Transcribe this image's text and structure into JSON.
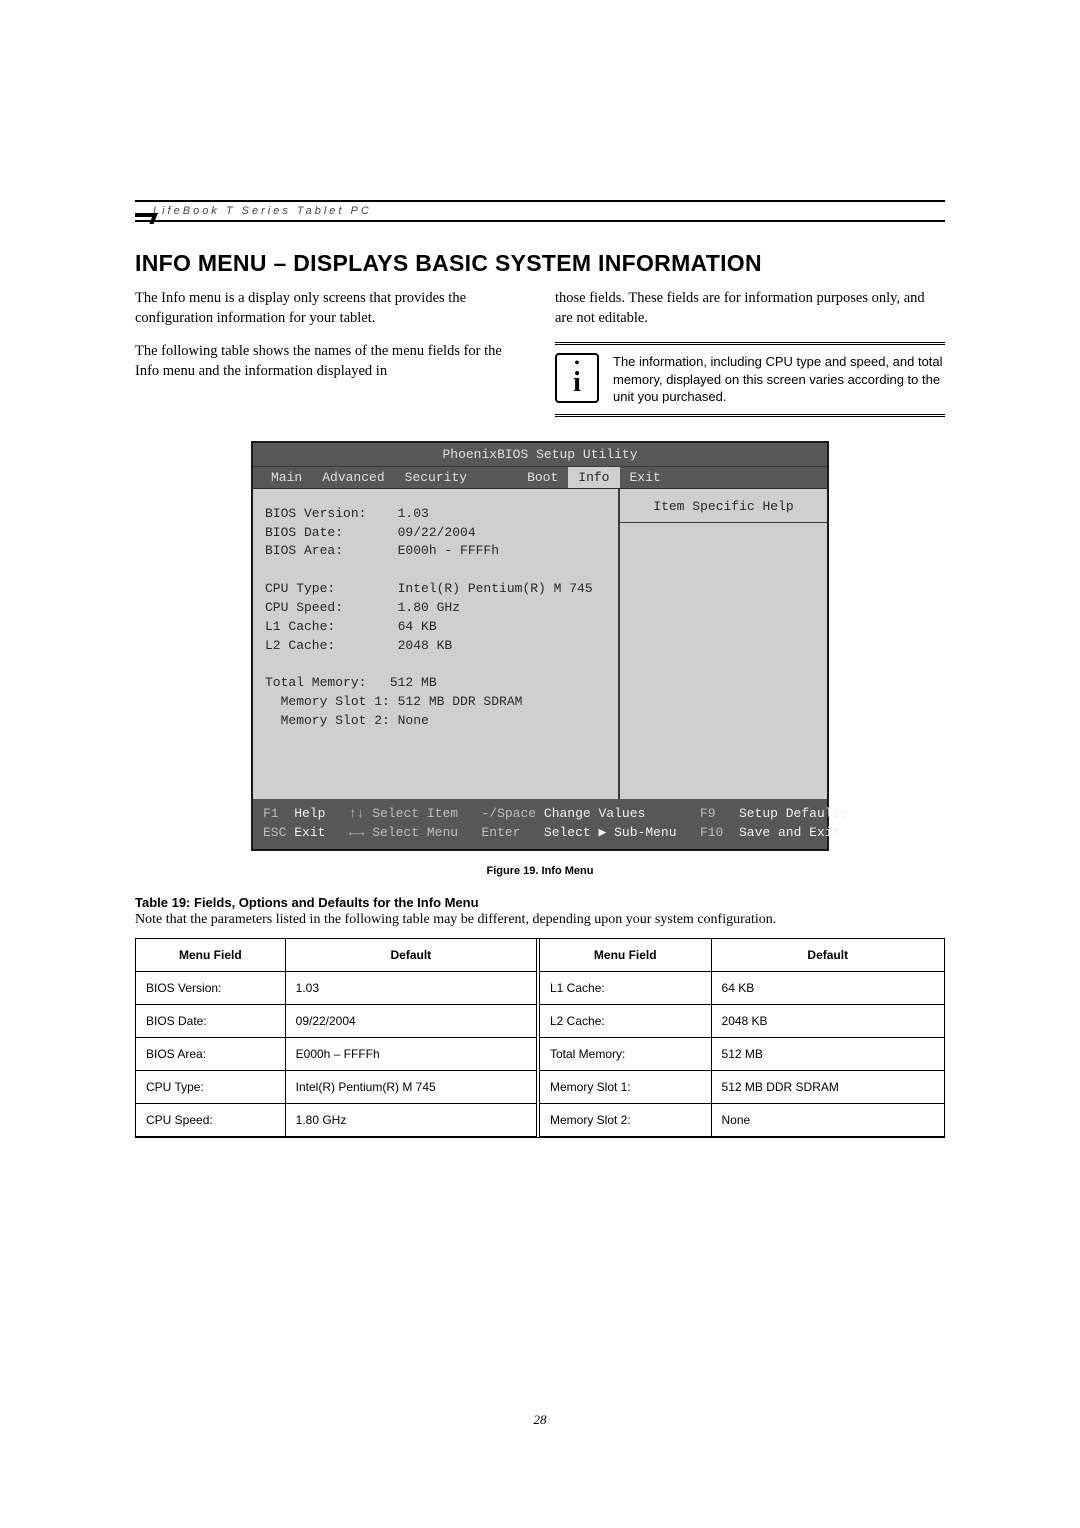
{
  "header": {
    "product_line": "LifeBook T Series Tablet PC"
  },
  "title": "INFO MENU – DISPLAYS BASIC SYSTEM INFORMATION",
  "para1": "The Info menu is a display only screens that provides the configuration information for your tablet.",
  "para2": "The following table shows the names of the menu fields for the Info menu and the information displayed in",
  "para3": "those fields. These fields are for information purposes only, and are not editable.",
  "callout_text": "The information, including CPU type and speed, and total memory, displayed on this screen varies according to the unit you purchased.",
  "bios": {
    "title": "PhoenixBIOS Setup Utility",
    "tabs": [
      "Main",
      "Advanced",
      "Security",
      "Boot",
      "Info",
      "Exit"
    ],
    "selected_tab": "Info",
    "help_title": "Item Specific Help",
    "lines_block1": "BIOS Version:    1.03\nBIOS Date:       09/22/2004\nBIOS Area:       E000h - FFFFh",
    "lines_block2": "CPU Type:        Intel(R) Pentium(R) M 745\nCPU Speed:       1.80 GHz\nL1 Cache:        64 KB\nL2 Cache:        2048 KB",
    "lines_block3": "Total Memory:   512 MB\n  Memory Slot 1: 512 MB DDR SDRAM\n  Memory Slot 2: None",
    "footer_l1_keys": "F1",
    "footer_l1_a": "Help",
    "footer_l1_b": "↑↓ Select Item",
    "footer_l1_c": "-/Space",
    "footer_l1_d": "Change Values",
    "footer_l1_e": "F9",
    "footer_l1_f": "Setup Defaults",
    "footer_l2_keys": "ESC",
    "footer_l2_a": "Exit",
    "footer_l2_b": "←→ Select Menu",
    "footer_l2_c": "Enter",
    "footer_l2_d": "Select ▶ Sub-Menu",
    "footer_l2_e": "F10",
    "footer_l2_f": "Save and Exit"
  },
  "figure_caption": "Figure 19.   Info Menu",
  "table_title": "Table 19: Fields, Options and Defaults for the Info Menu",
  "table_note": "Note that the parameters listed in the following table may be different, depending upon your system configuration.",
  "table_headers": {
    "field": "Menu Field",
    "default": "Default"
  },
  "left_rows": [
    {
      "f": "BIOS Version:",
      "d": "1.03"
    },
    {
      "f": "BIOS Date:",
      "d": "09/22/2004"
    },
    {
      "f": "BIOS Area:",
      "d": "E000h – FFFFh"
    },
    {
      "f": "CPU Type:",
      "d": "Intel(R) Pentium(R) M 745"
    },
    {
      "f": "CPU Speed:",
      "d": "1.80 GHz"
    }
  ],
  "right_rows": [
    {
      "f": "L1 Cache:",
      "d": "64 KB"
    },
    {
      "f": "L2 Cache:",
      "d": "2048 KB"
    },
    {
      "f": "Total Memory:",
      "d": "512 MB"
    },
    {
      "f": "Memory Slot 1:",
      "d": "512 MB DDR SDRAM"
    },
    {
      "f": "Memory Slot 2:",
      "d": "None"
    }
  ],
  "page_number": "28"
}
